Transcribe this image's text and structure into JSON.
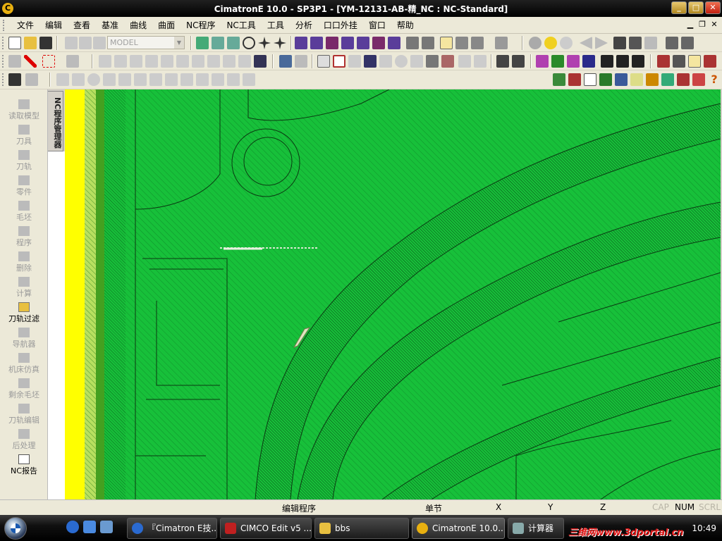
{
  "window": {
    "title": "CimatronE 10.0 - SP3P1 - [YM-12131-AB-精_NC : NC-Standard]"
  },
  "menu": [
    "文件",
    "编辑",
    "查看",
    "基准",
    "曲线",
    "曲面",
    "NC程序",
    "NC工具",
    "工具",
    "分析",
    "口口外挂",
    "窗口",
    "帮助"
  ],
  "toolbar": {
    "model_combo": "MODEL"
  },
  "left_panel": {
    "tab_label": "NC程序管理器",
    "items": [
      {
        "label": "读取模型",
        "enabled": false
      },
      {
        "label": "刀具",
        "enabled": false
      },
      {
        "label": "刀轨",
        "enabled": false
      },
      {
        "label": "零件",
        "enabled": false
      },
      {
        "label": "毛坯",
        "enabled": false
      },
      {
        "label": "程序",
        "enabled": false
      },
      {
        "label": "删除",
        "enabled": false
      },
      {
        "label": "计算",
        "enabled": false
      },
      {
        "label": "刀轨过滤",
        "enabled": true
      },
      {
        "label": "导航器",
        "enabled": false
      },
      {
        "label": "机床仿真",
        "enabled": false
      },
      {
        "label": "剩余毛坯",
        "enabled": false
      },
      {
        "label": "刀轨编辑",
        "enabled": false
      },
      {
        "label": "后处理",
        "enabled": false
      },
      {
        "label": "NC报告",
        "enabled": true
      }
    ]
  },
  "status_bar": {
    "mode": "编辑程序",
    "unit": "单节",
    "x_label": "X",
    "y_label": "Y",
    "z_label": "Z",
    "cap": "CAP",
    "num": "NUM",
    "scrl": "SCRL"
  },
  "taskbar": {
    "tasks": [
      {
        "label": "『Cimatron E技..."
      },
      {
        "label": "CIMCO Edit v5 ..."
      },
      {
        "label": "bbs"
      },
      {
        "label": "CimatronE 10.0..."
      },
      {
        "label": "计算器"
      }
    ],
    "watermark": "三维网www.3dportal.cn",
    "clock": "10:49"
  },
  "colors": {
    "viewport_green": "#17c03a",
    "stock_yellow": "#ffff00"
  }
}
